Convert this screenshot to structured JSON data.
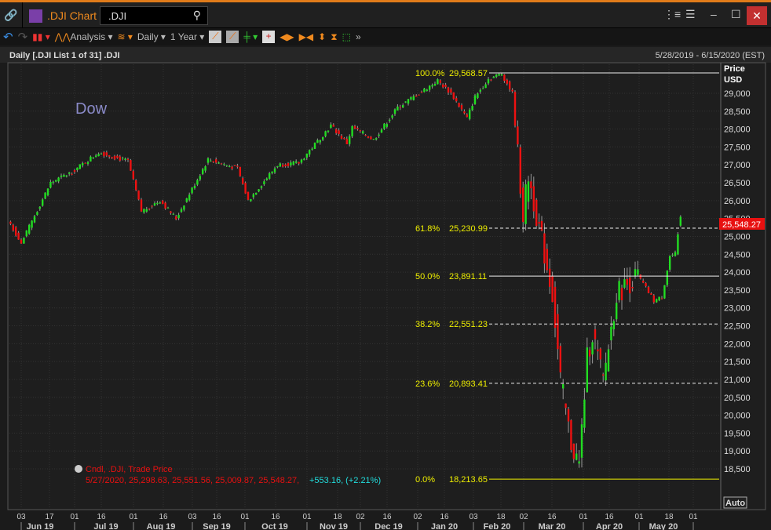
{
  "titlebar": {
    "app_title": ".DJI Chart",
    "search_value": ".DJI",
    "link_icon": "link-icon",
    "min": "–",
    "max": "☐",
    "close": "✕"
  },
  "toolbar": {
    "analysis": "Analysis",
    "interval": "Daily",
    "range": "1 Year"
  },
  "header": {
    "left": "Daily [.DJI List 1 of 31] .DJI",
    "right": "5/28/2019 - 6/15/2020 (EST)"
  },
  "chart_label": "Dow",
  "axis": {
    "title1": "Price",
    "title2": "USD",
    "auto": "Auto",
    "last_price": "25,548.27",
    "ticks": [
      "29,000",
      "28,500",
      "28,000",
      "27,500",
      "27,000",
      "26,500",
      "26,000",
      "25,500",
      "25,000",
      "24,500",
      "24,000",
      "23,500",
      "23,000",
      "22,500",
      "22,000",
      "21,500",
      "21,000",
      "20,500",
      "20,000",
      "19,500",
      "19,000",
      "18,500"
    ]
  },
  "date_ticks": [
    "03",
    "17",
    "01",
    "16",
    "01",
    "16",
    "03",
    "16",
    "01",
    "16",
    "01",
    "18",
    "02",
    "16",
    "02",
    "16",
    "03",
    "18",
    "02",
    "16",
    "01",
    "16",
    "01",
    "18",
    "01"
  ],
  "months": [
    "Jun 19",
    "Jul 19",
    "Aug 19",
    "Sep 19",
    "Oct 19",
    "Nov 19",
    "Dec 19",
    "Jan 20",
    "Feb 20",
    "Mar 20",
    "Apr 20",
    "May 20"
  ],
  "fib": [
    {
      "pct": "100.0%",
      "val": "29,568.57",
      "price": 29568.57,
      "style": "solid"
    },
    {
      "pct": "61.8%",
      "val": "25,230.99",
      "price": 25230.99,
      "style": "dashed"
    },
    {
      "pct": "50.0%",
      "val": "23,891.11",
      "price": 23891.11,
      "style": "solid"
    },
    {
      "pct": "38.2%",
      "val": "22,551.23",
      "price": 22551.23,
      "style": "dashed"
    },
    {
      "pct": "23.6%",
      "val": "20,893.41",
      "price": 20893.41,
      "style": "dashed"
    },
    {
      "pct": "0.0%",
      "val": "18,213.65",
      "price": 18213.65,
      "style": "solid"
    }
  ],
  "legend": {
    "line1": "Cndl, .DJI, Trade Price",
    "line2": "5/27/2020, 25,298.63, 25,551.56, 25,009.87, 25,548.27,",
    "change": "+553.16, (+2.21%)"
  },
  "colors": {
    "up": "#22dd22",
    "down": "#ee1111",
    "fib_text": "#eeee00",
    "accent": "#e07b1a"
  },
  "chart_data": {
    "type": "candlestick",
    "ylim": [
      18213,
      29750
    ],
    "waypoints": [
      [
        0,
        25350
      ],
      [
        4,
        24800
      ],
      [
        15,
        26500
      ],
      [
        23,
        26800
      ],
      [
        33,
        27350
      ],
      [
        44,
        27100
      ],
      [
        49,
        25700
      ],
      [
        56,
        26000
      ],
      [
        62,
        25500
      ],
      [
        74,
        27150
      ],
      [
        85,
        26900
      ],
      [
        89,
        26000
      ],
      [
        100,
        27000
      ],
      [
        108,
        27050
      ],
      [
        120,
        28100
      ],
      [
        126,
        27600
      ],
      [
        128,
        28050
      ],
      [
        136,
        27700
      ],
      [
        145,
        28600
      ],
      [
        160,
        29350
      ],
      [
        165,
        29000
      ],
      [
        171,
        28300
      ],
      [
        174,
        28900
      ],
      [
        179,
        29400
      ],
      [
        184,
        29550
      ],
      [
        188,
        29000
      ],
      [
        192,
        25600
      ],
      [
        194,
        26700
      ],
      [
        200,
        24500
      ],
      [
        203,
        23400
      ],
      [
        206,
        21000
      ],
      [
        210,
        19200
      ],
      [
        213,
        18600
      ],
      [
        216,
        21600
      ],
      [
        218,
        22300
      ],
      [
        222,
        20950
      ],
      [
        227,
        23400
      ],
      [
        230,
        23600
      ],
      [
        235,
        23900
      ],
      [
        241,
        23200
      ],
      [
        244,
        23300
      ],
      [
        247,
        24450
      ],
      [
        249,
        24500
      ],
      [
        250,
        24995
      ],
      [
        251,
        25548
      ]
    ]
  }
}
